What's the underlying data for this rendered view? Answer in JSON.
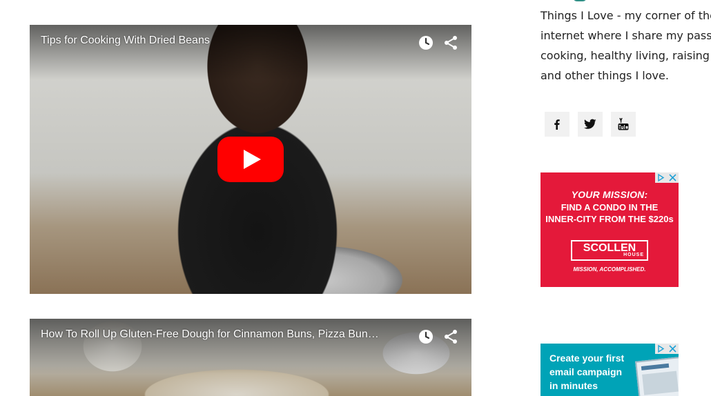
{
  "videos": [
    {
      "title": "Tips for Cooking With Dried Beans",
      "watch_later_icon": "clock-icon",
      "share_icon": "share-arrow-icon",
      "play_icon": "youtube-play-icon"
    },
    {
      "title": "How To Roll Up Gluten-Free Dough for Cinnamon Buns, Pizza Bun…",
      "watch_later_icon": "clock-icon",
      "share_icon": "share-arrow-icon"
    }
  ],
  "sidebar": {
    "about_lines": [
      "Things I Love - my corner of the",
      "internet where I share my passio",
      "cooking, healthy living, raising a",
      "and other things I love."
    ],
    "social": [
      {
        "icon": "facebook-icon"
      },
      {
        "icon": "twitter-icon"
      },
      {
        "icon": "youtube-icon"
      }
    ]
  },
  "ads": {
    "ad1": {
      "mission": "YOUR MISSION:",
      "lines": [
        "FIND A CONDO IN THE",
        "INNER-CITY FROM THE $220s"
      ],
      "brand": "SCOLLEN",
      "brand_sub": "HOUSE",
      "tagline": "MISSION, ACCOMPLISHED.",
      "color": "#e4193a"
    },
    "ad2": {
      "lines": [
        "Create your first",
        "email campaign",
        "in minutes"
      ],
      "color": "#00a3b7"
    },
    "adchoices_icons": [
      "adchoices-icon",
      "close-x-icon"
    ]
  },
  "colors": {
    "accent": "#2f8f86",
    "youtube_red": "#ff0000"
  }
}
